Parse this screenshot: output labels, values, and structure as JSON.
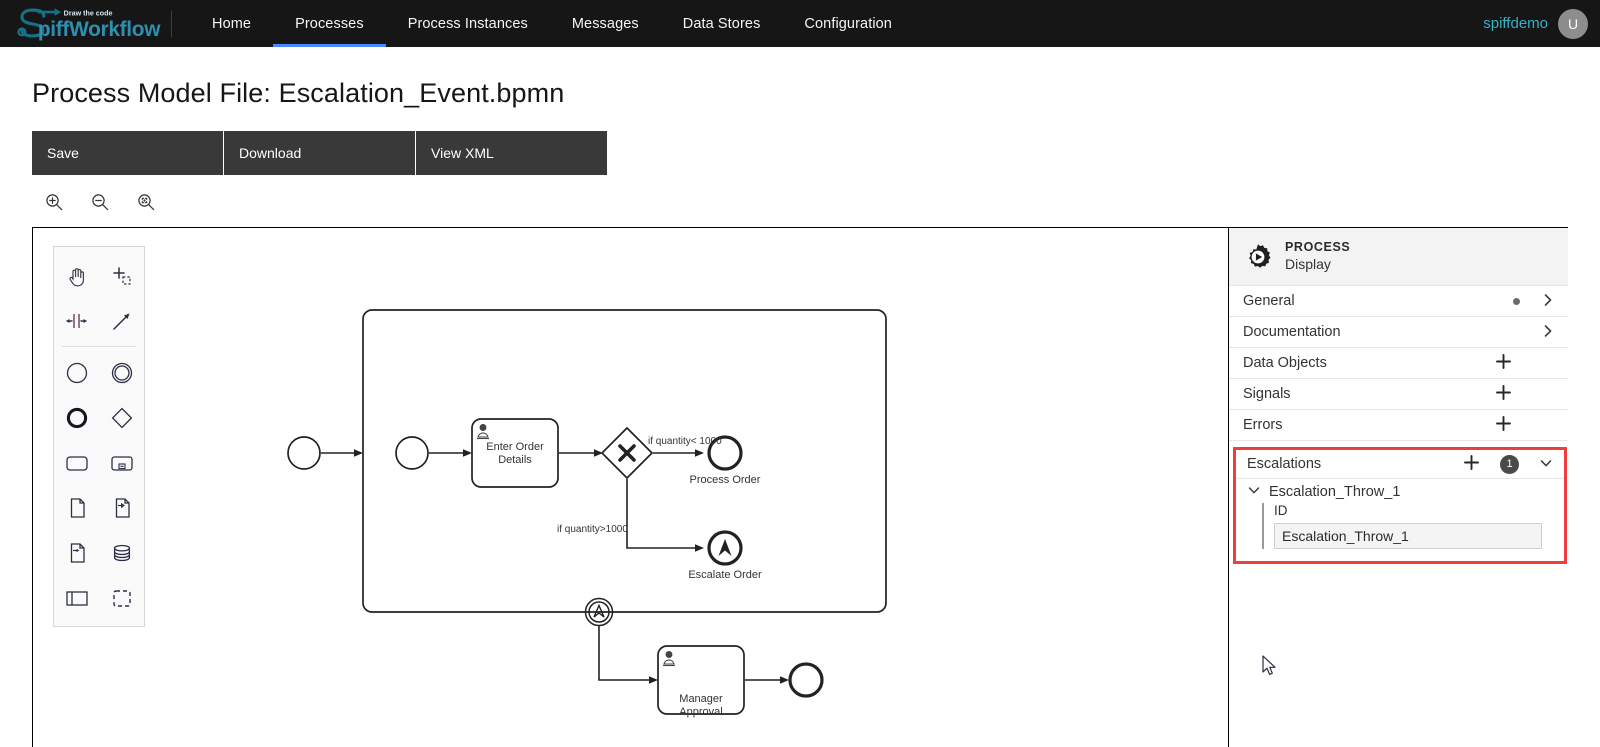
{
  "nav": {
    "brand": {
      "tagline": "Draw the code",
      "name": "SpiffWorkflow"
    },
    "items": [
      {
        "label": "Home",
        "active": false
      },
      {
        "label": "Processes",
        "active": true
      },
      {
        "label": "Process Instances",
        "active": false
      },
      {
        "label": "Messages",
        "active": false
      },
      {
        "label": "Data Stores",
        "active": false
      },
      {
        "label": "Configuration",
        "active": false
      }
    ],
    "user": {
      "name": "spiffdemo",
      "initial": "U"
    },
    "accent": "#4589ff",
    "brand_color": "#0f6e84",
    "bar_color": "#161616"
  },
  "page": {
    "title": "Process Model File: Escalation_Event.bpmn"
  },
  "toolbar": {
    "buttons": [
      {
        "label": "Save"
      },
      {
        "label": "Download"
      },
      {
        "label": "View XML"
      }
    ],
    "bg": "#393939"
  },
  "zoom_controls": [
    {
      "name": "zoom-in-icon",
      "title": "Zoom In"
    },
    {
      "name": "zoom-out-icon",
      "title": "Zoom Out"
    },
    {
      "name": "zoom-reset-icon",
      "title": "Reset Zoom"
    }
  ],
  "palette": {
    "items": [
      {
        "name": "hand-tool-icon",
        "label": "Activate hand tool"
      },
      {
        "name": "lasso-tool-icon",
        "label": "Activate lasso tool"
      },
      {
        "name": "space-tool-icon",
        "label": "Activate create/remove space tool"
      },
      {
        "name": "connect-tool-icon",
        "label": "Activate global connect tool"
      },
      {
        "name": "start-event-icon",
        "label": "Create StartEvent"
      },
      {
        "name": "intermediate-event-icon",
        "label": "Create Intermediate/Boundary Event"
      },
      {
        "name": "end-event-icon",
        "label": "Create EndEvent"
      },
      {
        "name": "gateway-icon",
        "label": "Create Gateway"
      },
      {
        "name": "task-icon",
        "label": "Create Task"
      },
      {
        "name": "subprocess-icon",
        "label": "Create expanded SubProcess"
      },
      {
        "name": "data-object-icon",
        "label": "Create DataObjectReference"
      },
      {
        "name": "data-input-icon",
        "label": "Create DataInput"
      },
      {
        "name": "data-output-icon",
        "label": "Create DataOutput"
      },
      {
        "name": "data-store-icon",
        "label": "Create DataStoreReference"
      },
      {
        "name": "participant-icon",
        "label": "Create Pool/Participant"
      },
      {
        "name": "group-icon",
        "label": "Create Group"
      }
    ]
  },
  "diagram": {
    "type": "bpmn",
    "elements": [
      {
        "name": "start-event",
        "kind": "startEvent",
        "label": ""
      },
      {
        "name": "subprocess",
        "kind": "subProcess",
        "label": ""
      },
      {
        "name": "inner-start-event",
        "kind": "startEvent",
        "label": ""
      },
      {
        "name": "enter-order-details-task",
        "kind": "userTask",
        "label": "Enter Order Details"
      },
      {
        "name": "quantity-gateway",
        "kind": "exclusiveGateway",
        "label": ""
      },
      {
        "name": "process-order-end-event",
        "kind": "endEvent",
        "label": "Process Order"
      },
      {
        "name": "escalate-order-event",
        "kind": "escalationEndEvent",
        "label": "Escalate Order"
      },
      {
        "name": "escalation-boundary-event",
        "kind": "escalationBoundaryEvent",
        "label": ""
      },
      {
        "name": "manager-approval-task",
        "kind": "userTask",
        "label": "Manager Approval"
      },
      {
        "name": "final-end-event",
        "kind": "endEvent",
        "label": ""
      }
    ],
    "flow_labels": [
      {
        "name": "flow-label-low-quantity",
        "text": "if quantity< 1000"
      },
      {
        "name": "flow-label-high-quantity",
        "text": "if quantity>1000"
      }
    ],
    "task_labels": {
      "enter_order_line1": "Enter Order",
      "enter_order_line2": "Details",
      "manager_line1": "Manager",
      "manager_line2": "Approval"
    }
  },
  "properties_panel": {
    "header": {
      "kind": "PROCESS",
      "name": "Display",
      "icon": "process-gear-icon"
    },
    "sections": [
      {
        "name": "general",
        "label": "General",
        "indicator": "dot",
        "action": "chevron-right"
      },
      {
        "name": "documentation",
        "label": "Documentation",
        "indicator": "",
        "action": "chevron-right"
      },
      {
        "name": "data-objects",
        "label": "Data Objects",
        "indicator": "",
        "action": "plus"
      },
      {
        "name": "signals",
        "label": "Signals",
        "indicator": "",
        "action": "plus"
      },
      {
        "name": "errors",
        "label": "Errors",
        "indicator": "",
        "action": "plus"
      }
    ],
    "escalations": {
      "label": "Escalations",
      "count": "1",
      "add_icon": "plus-icon",
      "toggle_icon": "chevron-down-icon",
      "highlight_color": "#f03e3e",
      "entry": {
        "name": "Escalation_Throw_1",
        "field_label": "ID",
        "field_value": "Escalation_Throw_1"
      }
    }
  }
}
